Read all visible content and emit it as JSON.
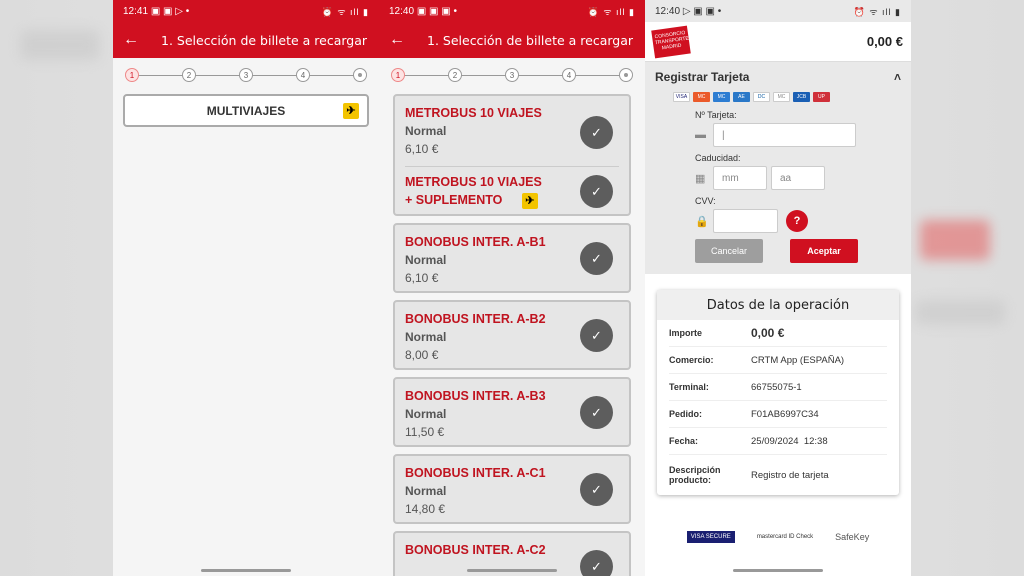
{
  "screen1": {
    "status": {
      "time": "12:41",
      "icons_left": "▣ ▣ ▷ •",
      "icons_right": "⏰ ᯤ ıll ▮"
    },
    "title": "1. Selección de billete a recargar",
    "steps": [
      "1",
      "2",
      "3",
      "4",
      ""
    ],
    "multiviajes_label": "MULTIVIAJES"
  },
  "screen2": {
    "status": {
      "time": "12:40",
      "icons_left": "▣ ▣ ▣ •",
      "icons_right": "⏰ ᯤ ıll ▮"
    },
    "title": "1. Selección de billete a recargar",
    "steps": [
      "1",
      "2",
      "3",
      "4",
      ""
    ],
    "tickets": [
      {
        "name": "METROBUS 10 VIAJES",
        "sub": "Normal",
        "price": "6,10 €"
      },
      {
        "name": "METROBUS 10 VIAJES",
        "name2": "+ SUPLEMENTO"
      },
      {
        "name": "BONOBUS INTER. A-B1",
        "sub": "Normal",
        "price": "6,10 €"
      },
      {
        "name": "BONOBUS INTER. A-B2",
        "sub": "Normal",
        "price": "8,00 €"
      },
      {
        "name": "BONOBUS INTER. A-B3",
        "sub": "Normal",
        "price": "11,50 €"
      },
      {
        "name": "BONOBUS INTER. A-C1",
        "sub": "Normal",
        "price": "14,80 €"
      },
      {
        "name": "BONOBUS INTER. A-C2"
      }
    ]
  },
  "screen3": {
    "status": {
      "time": "12:40",
      "icons_left": "▷ ▣ ▣ •",
      "icons_right": "⏰ ᯤ ıll ▮"
    },
    "logo_text": "CONSORCIO TRANSPORTES MADRID",
    "amount": "0,00 €",
    "register_title": "Registrar Tarjeta",
    "card_brands": [
      "VISA",
      "MC",
      "MC",
      "AE",
      "DC",
      "MC",
      "JCB",
      "UP"
    ],
    "card_number_label": "Nº Tarjeta:",
    "expiry_label": "Caducidad:",
    "month_placeholder": "mm",
    "year_placeholder": "aa",
    "cvv_label": "CVV:",
    "help_label": "?",
    "cancel_label": "Cancelar",
    "accept_label": "Aceptar",
    "operation": {
      "title": "Datos de la operación",
      "rows": [
        {
          "k": "Importe",
          "v": "0,00 €"
        },
        {
          "k": "Comercio:",
          "v": "CRTM App (ESPAÑA)"
        },
        {
          "k": "Terminal:",
          "v": "66755075-1"
        },
        {
          "k": "Pedido:",
          "v": "F01AB6997C34"
        },
        {
          "k": "Fecha:",
          "v": "25/09/2024  12:38"
        },
        {
          "k": "Descripción producto:",
          "v": "Registro de tarjeta"
        }
      ]
    },
    "secure_logos": [
      "VISA SECURE",
      "mastercard ID Check",
      "SafeKey"
    ]
  },
  "colors": {
    "brand_red": "#d01020",
    "check_gray": "#5d5d5d",
    "plane_yellow": "#f3c400"
  }
}
